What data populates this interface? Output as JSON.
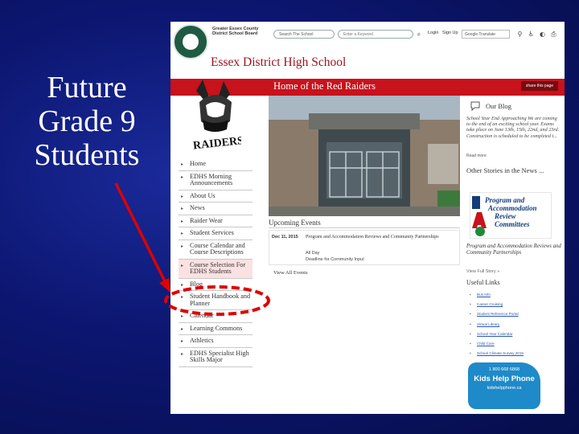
{
  "slide": {
    "title_lines": [
      "Future",
      "Grade 9",
      "Students"
    ]
  },
  "header": {
    "board_name_lines": [
      "Greater Essex County",
      "District School Board"
    ],
    "search_school": "Search The School",
    "keyword_placeholder": "Enter a Keyword",
    "login": "Login",
    "signup": "Sign Up",
    "translate": "Google Translate",
    "school_name": "Essex District High School"
  },
  "banner": {
    "title": "Home of the Red Raiders",
    "share": "share this page"
  },
  "logo_text": "RAIDERS",
  "nav": {
    "items": [
      "Home",
      "EDHS Morning Announcements",
      "About Us",
      "News",
      "Raider Wear",
      "Student Services",
      "Course Calendar and Course Descriptions",
      "Course Selection For EDHS Students",
      "Blog",
      "Student Handbook and Planner",
      "Calendar",
      "Learning Commons",
      "Athletics",
      "EDHS Specialist High Skills Major"
    ]
  },
  "events": {
    "title": "Upcoming Events",
    "date": "Dec 11, 2015",
    "event_title": "Program and Accommodation Reviews and Community Partnerships",
    "day": "All Day",
    "description": "Deadline for Community Input",
    "view_all": "View All Events"
  },
  "blog": {
    "title": "Our Blog",
    "text": "School Year End Approaching We are coming to the end of an exciting school year. Exams take place on June 13th, 15th, 22nd, and 23rd. Construction is scheduled to be completed t...",
    "more": "Read more",
    "other_stories": "Other Stories in the News ...",
    "par_logo_lines": [
      "Program and",
      "Accommodation",
      "Review",
      "Committees"
    ],
    "par_caption": "Program and Accommodation Reviews and Community Partnerships",
    "full_story": "View Full Story »"
  },
  "useful_links": {
    "title": "Useful Links",
    "items": [
      "Bus Info",
      "Career Cruising",
      "Student Reference Portal",
      "Virtual Library",
      "School Year Calendar",
      "Child Care",
      "School Climate Survey 2015"
    ]
  },
  "kids_help": {
    "phone": "1 800 668 6868",
    "name": "Kids Help Phone",
    "url": "kidshelpphone.ca"
  },
  "colors": {
    "school_red": "#c8121c",
    "slide_blue": "#0c1670",
    "highlight_red": "#e00000"
  }
}
